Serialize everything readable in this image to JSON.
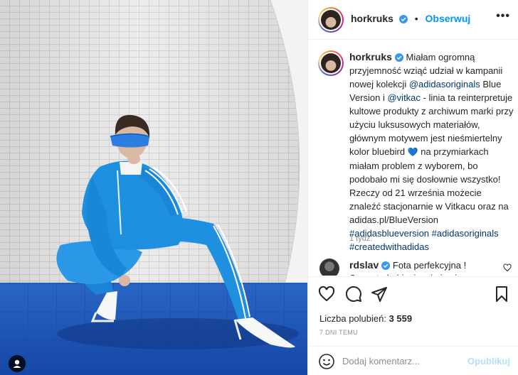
{
  "post": {
    "username": "horkruks",
    "follow_label": "Obserwuj",
    "more_label": "•••",
    "dot": "•"
  },
  "caption": {
    "username": "horkruks",
    "p1": "Miałam ogromną przyjemność wziąć udział w kampanii nowej kolekcji ",
    "mention1": "@adidasoriginals",
    "p2": " Blue Version i ",
    "mention2": "@vitkac",
    "p3": " - linia ta reinterpretuje kultowe produkty z archiwum marki przy użyciu luksusowych materiałów, głównym motywem jest nieśmiertelny kolor bluebird ",
    "emoji": "💙",
    "p4": " na przymiarkach miałam problem z wyborem, bo podobało mi się dosłownie wszystko! Rzeczy od 21 września możecie znaleźć stacjonarnie w Vitkacu oraz na adidas.pl/BlueVersion",
    "hashtags": "#adidasblueversion #adidasoriginals #createdwithadidas",
    "time": "1 tydz."
  },
  "comment2": {
    "username": "rdslav",
    "text": "Fota perfekcyjna ! Super to kobieciecej nic nie ubieraj 💙"
  },
  "likes": {
    "label": "Liczba polubień: ",
    "count": "3 559"
  },
  "age": "7 DNI TEMU",
  "add_comment": {
    "placeholder": "Dodaj komentarz...",
    "publish_label": "Opublikuj"
  },
  "icons": [
    "heart-icon",
    "comment-icon",
    "share-icon",
    "bookmark-icon",
    "emoji-icon",
    "more-icon",
    "verified-icon"
  ],
  "colors": {
    "accent": "#0095f6",
    "verified": "#3897f0",
    "publish_disabled": "#b2dffc",
    "floor_blue": "#1f5fc0",
    "tracksuit_blue": "#1f8fe0"
  }
}
